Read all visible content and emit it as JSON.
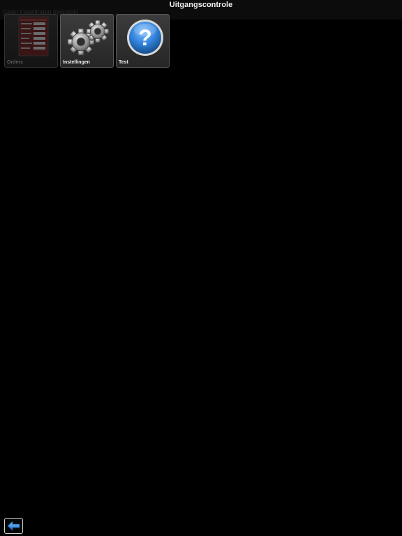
{
  "header": {
    "title": "Uitgangscontrole",
    "status_text": "Geen instellingen ingesteld"
  },
  "tiles": [
    {
      "label": "Orders",
      "icon": "orders-form-icon",
      "enabled": false
    },
    {
      "label": "Instellingen",
      "icon": "gears-icon",
      "enabled": true
    },
    {
      "label": "Test",
      "icon": "help-question-icon",
      "enabled": true
    }
  ],
  "footer": {
    "back_icon": "arrow-left-icon"
  },
  "colors": {
    "background": "#000000",
    "tile_border": "#5a5a5a",
    "help_icon_blue": "#2f7fd8",
    "back_arrow_blue": "#2b8ae6"
  }
}
